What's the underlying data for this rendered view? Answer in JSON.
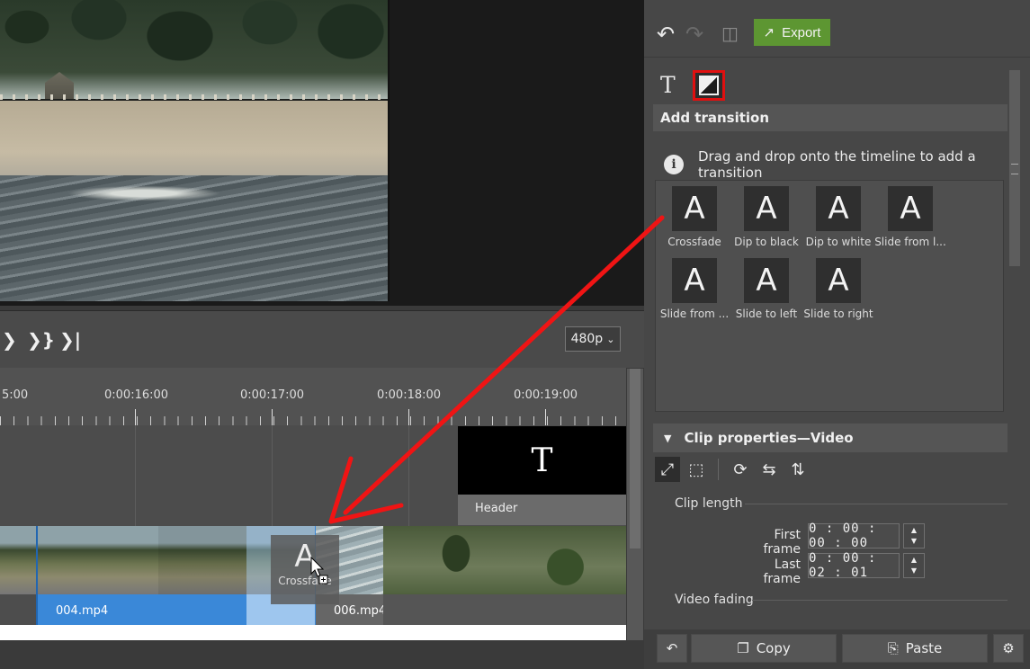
{
  "toolbar": {
    "export_label": "Export"
  },
  "tabs": {
    "text_tab": "T",
    "transitions_tab": "transition-icon"
  },
  "transitions": {
    "header": "Add transition",
    "info": "Drag and drop onto the timeline to add a transition",
    "items": [
      {
        "letter": "A",
        "label": "Crossfade"
      },
      {
        "letter": "A",
        "label": "Dip to black"
      },
      {
        "letter": "A",
        "label": "Dip to white"
      },
      {
        "letter": "A",
        "label": "Slide from l..."
      },
      {
        "letter": "A",
        "label": "Slide from ..."
      },
      {
        "letter": "A",
        "label": "Slide to left"
      },
      {
        "letter": "A",
        "label": "Slide to right"
      }
    ]
  },
  "clip_properties": {
    "header": "Clip properties—Video",
    "clip_length_label": "Clip length",
    "first_frame_label": "First frame",
    "first_frame_value": "0 : 00 : 00 : 00",
    "last_frame_label": "Last frame",
    "last_frame_value": "0 : 00 : 02 : 01",
    "video_fading_label": "Video fading"
  },
  "bottom": {
    "copy_label": "Copy",
    "paste_label": "Paste"
  },
  "player": {
    "resolution": "480p"
  },
  "timeline": {
    "ticks": [
      "5:00",
      "0:00:16:00",
      "0:00:17:00",
      "0:00:18:00",
      "0:00:19:00"
    ],
    "title_clip": {
      "letter": "T",
      "name": "Header"
    },
    "clips": [
      {
        "name": ""
      },
      {
        "name": "004.mp4"
      },
      {
        "name": "006.mp4"
      }
    ],
    "drag_ghost": {
      "letter": "A",
      "label": "Crossfade"
    }
  },
  "colors": {
    "accent_green": "#5d9632",
    "highlight_red": "#e01010",
    "clip_selected_blue": "#3a88d8"
  }
}
